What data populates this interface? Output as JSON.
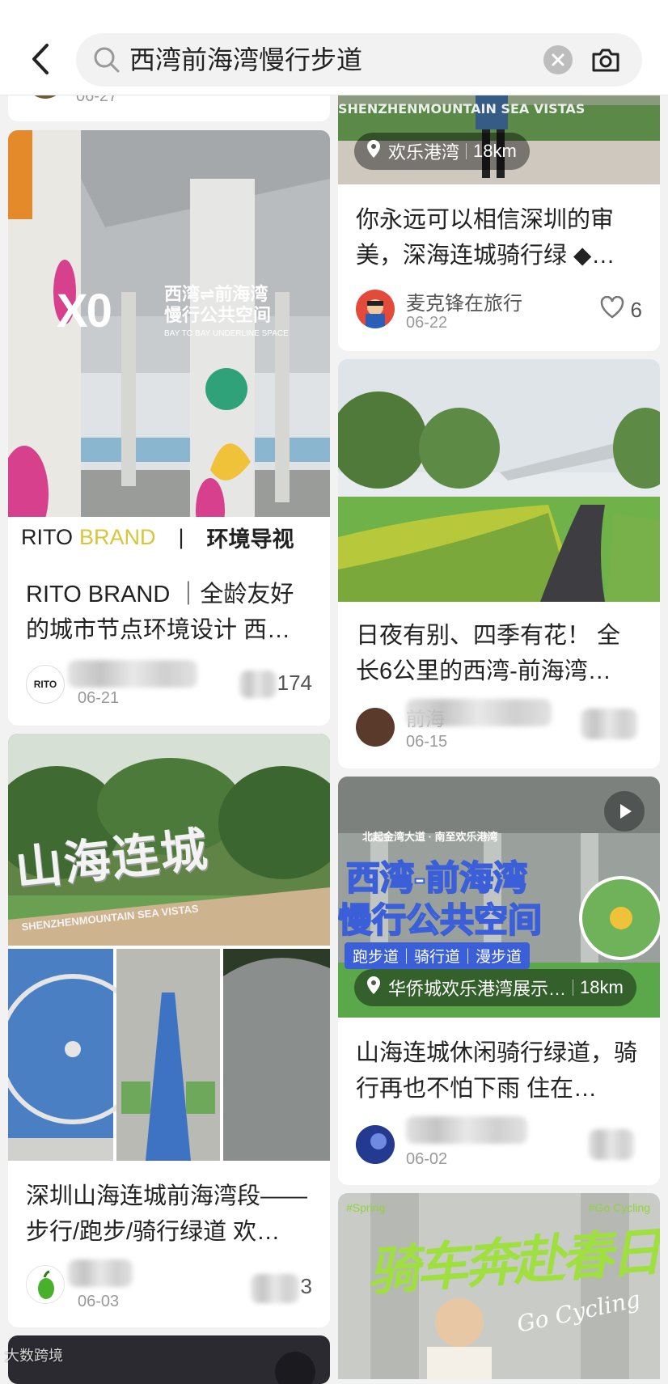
{
  "search": {
    "query": "西湾前海湾慢行步道"
  },
  "cards": {
    "top_left": {
      "date": "06-27"
    },
    "rito": {
      "banner_logo": "X0",
      "banner_title1": "西湾⇌前海湾",
      "banner_title2": "慢行公共空间",
      "banner_sub": "BAY TO BAY UNDERLINE SPACE",
      "brand_a": "RITO",
      "brand_b": "BRAND",
      "brand_divider": "|",
      "brand_c": "环境导视",
      "title": "RITO BRAND ｜全龄友好的城市节点环境设计 西…",
      "avatar_text": "RITO",
      "date": "06-21",
      "likes": "174"
    },
    "shan": {
      "sign_text": "SHENZHENMOUNTAIN SEA VISTAS",
      "sign_cn": "山海连城",
      "title": "深圳山海连城前海湾段——步行/跑步/骑行绿道 欢…",
      "date": "06-03",
      "likes": "3"
    },
    "travel": {
      "location": "欢乐港湾",
      "distance": "18km",
      "title": "你永远可以相信深圳的审美，深海连城骑行绿 ◆…",
      "author": "麦克锋在旅行",
      "date": "06-22",
      "likes": "6"
    },
    "park": {
      "title": "日夜有别、四季有花！ 全长6公里的西湾-前海湾…",
      "author": "前海",
      "date": "06-15"
    },
    "video": {
      "overlay_small": "北起金湾大道 · 南至欢乐港湾",
      "overlay_big1": "西湾-前海湾",
      "overlay_big2": "慢行公共空间",
      "overlay_tag": "跑步道｜骑行道｜漫步道",
      "location": "华侨城欢乐港湾展示…",
      "distance": "18km",
      "title": "山海连城休闲骑行绿道，骑行再也不怕下雨 住在…",
      "date": "06-02"
    },
    "spring": {
      "tag_left": "#Spring",
      "tag_right": "#Go Cycling",
      "big_text": "骑车奔赴春日",
      "script_text": "Go Cycling"
    }
  },
  "watermark": "大数跨境",
  "colors": {
    "brand_yellow": "#d7c63a",
    "green": "#8fd43a",
    "accent_blue": "#3a5fd8"
  }
}
